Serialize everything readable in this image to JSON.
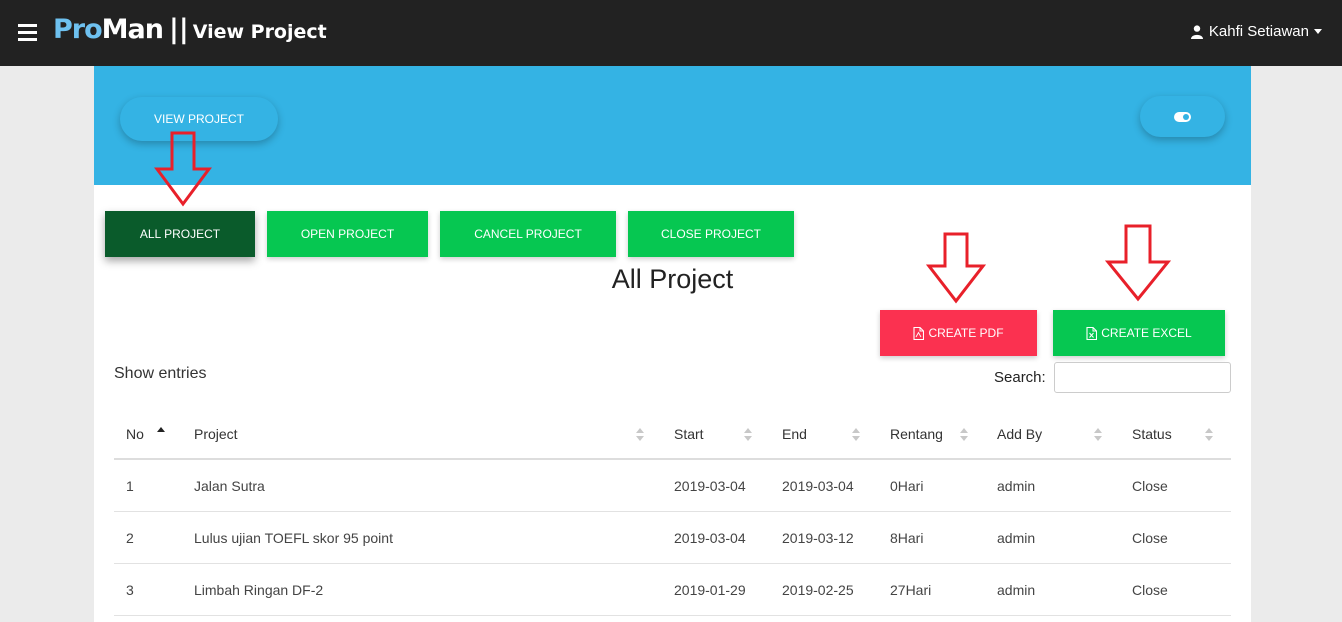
{
  "navbar": {
    "brand_pro": "Pro",
    "brand_man": "Man",
    "brand_sep": "||",
    "page_name": "View Project",
    "user_name": "Kahfi Setiawan"
  },
  "header": {
    "view_button": "VIEW PROJECT"
  },
  "tabs": [
    "ALL PROJECT",
    "OPEN PROJECT",
    "CANCEL PROJECT",
    "CLOSE PROJECT"
  ],
  "page_title": "All Project",
  "export": {
    "pdf_label": "CREATE PDF",
    "excel_label": "CREATE EXCEL"
  },
  "table_controls": {
    "show_entries": "Show entries",
    "search_label": "Search:",
    "search_value": ""
  },
  "table": {
    "columns": [
      "No",
      "Project",
      "Start",
      "End",
      "Rentang",
      "Add By",
      "Status"
    ],
    "rows": [
      [
        "1",
        "Jalan Sutra",
        "2019-03-04",
        "2019-03-04",
        "0Hari",
        "admin",
        "Close"
      ],
      [
        "2",
        "Lulus ujian TOEFL skor 95 point",
        "2019-03-04",
        "2019-03-12",
        "8Hari",
        "admin",
        "Close"
      ],
      [
        "3",
        "Limbah Ringan DF-2",
        "2019-01-29",
        "2019-02-25",
        "27Hari",
        "admin",
        "Close"
      ]
    ]
  },
  "colors": {
    "navbar": "#222222",
    "header": "#34b3e4",
    "tab_active": "#0a5b2b",
    "tab": "#06c751",
    "pdf": "#fb3150",
    "excel": "#06c751",
    "annotation_arrow": "#e8202a"
  },
  "icons": [
    "menu-icon",
    "user-icon",
    "toggle-icon",
    "pdf-file-icon",
    "excel-file-icon",
    "sort-icon"
  ]
}
